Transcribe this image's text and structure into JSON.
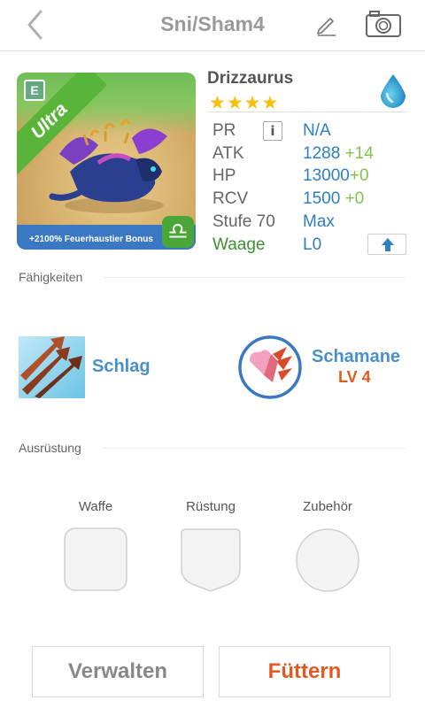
{
  "header": {
    "title": "Sni/Sham4"
  },
  "pet": {
    "name": "Drizzaurus",
    "stars": 4,
    "rarity": "Ultra",
    "badge": "E",
    "bonus": "+2100% Feuerhaustier Bonus",
    "zodiac": "♎"
  },
  "stats": [
    {
      "label": "PR",
      "value": "N/A",
      "bonus": ""
    },
    {
      "label": "ATK",
      "value": "1288",
      "bonus": "+14"
    },
    {
      "label": "HP",
      "value": "13000",
      "bonus": "+0"
    },
    {
      "label": "RCV",
      "value": "1500",
      "bonus": "+0"
    },
    {
      "label": "Stufe 70",
      "value": "Max",
      "bonus": ""
    },
    {
      "label": "Waage",
      "value": "L0",
      "bonus": ""
    }
  ],
  "abilities": {
    "heading": "Fähigkeiten",
    "skill1": {
      "name": "Schlag"
    },
    "skill2": {
      "name": "Schamane",
      "level": "LV 4"
    }
  },
  "equipment": {
    "heading": "Ausrüstung",
    "slots": [
      {
        "label": "Waffe"
      },
      {
        "label": "Rüstung"
      },
      {
        "label": "Zubehör"
      }
    ]
  },
  "buttons": {
    "manage": "Verwalten",
    "feed": "Füttern"
  },
  "colors": {
    "accent_blue": "#2d7fc1",
    "bonus_green": "#7bc64a",
    "feed_orange": "#e05a22",
    "star_gold": "#f5bf0f"
  }
}
